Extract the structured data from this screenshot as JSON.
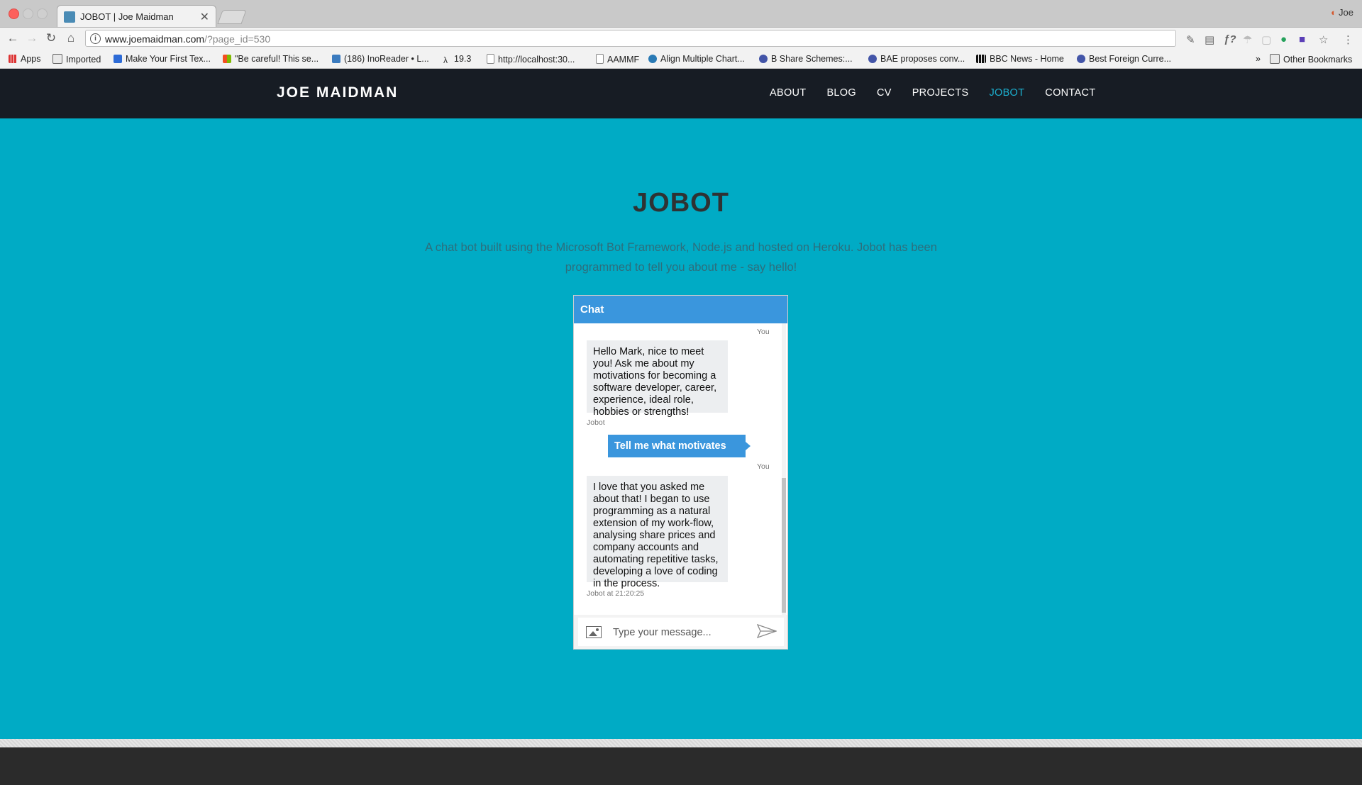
{
  "browser": {
    "tab_title": "JOBOT | Joe Maidman",
    "tab_close": "✕",
    "profile_name": "Joe",
    "url_host": "www.joemaidman.com",
    "url_path": "/?page_id=530",
    "bookmarks": [
      {
        "label": "Apps"
      },
      {
        "label": "Imported"
      },
      {
        "label": "Make Your First Tex..."
      },
      {
        "label": "\"Be careful! This se..."
      },
      {
        "label": "(186) InoReader • L..."
      },
      {
        "label": "19.3"
      },
      {
        "label": "http://localhost:30..."
      },
      {
        "label": "AAMMF"
      },
      {
        "label": "Align Multiple Chart..."
      },
      {
        "label": "B Share Schemes:..."
      },
      {
        "label": "BAE proposes conv..."
      },
      {
        "label": "BBC News - Home"
      },
      {
        "label": "Best Foreign Curre..."
      }
    ],
    "bookmarks_overflow": "»",
    "other_bookmarks": "Other Bookmarks"
  },
  "site": {
    "logo": "JOE MAIDMAN",
    "nav": [
      "ABOUT",
      "BLOG",
      "CV",
      "PROJECTS",
      "JOBOT",
      "CONTACT"
    ],
    "active_nav": "JOBOT",
    "accent_color": "#00abc5",
    "header_color": "#171c24"
  },
  "page": {
    "title": "JOBOT",
    "description": "A chat bot built using the Microsoft Bot Framework, Node.js and hosted on Heroku. Jobot has been programmed to tell you about me - say hello!"
  },
  "chat": {
    "header": "Chat",
    "messages": [
      {
        "from": "user",
        "meta": "You"
      },
      {
        "from": "bot",
        "text": "Hello Mark, nice to meet you! Ask me about my motivations for becoming a software developer, career, experience, ideal role, hobbies or strengths!",
        "meta": "Jobot"
      },
      {
        "from": "user",
        "text": "Tell me what motivates you Joe.",
        "meta": "You"
      },
      {
        "from": "bot",
        "text": "I love that you asked me about that! I began to use programming as a natural extension of my work-flow, analysing share prices and company accounts and automating repetitive tasks, developing a love of coding in the process.",
        "meta": "Jobot at 21:20:25"
      }
    ],
    "input_placeholder": "Type your message..."
  }
}
